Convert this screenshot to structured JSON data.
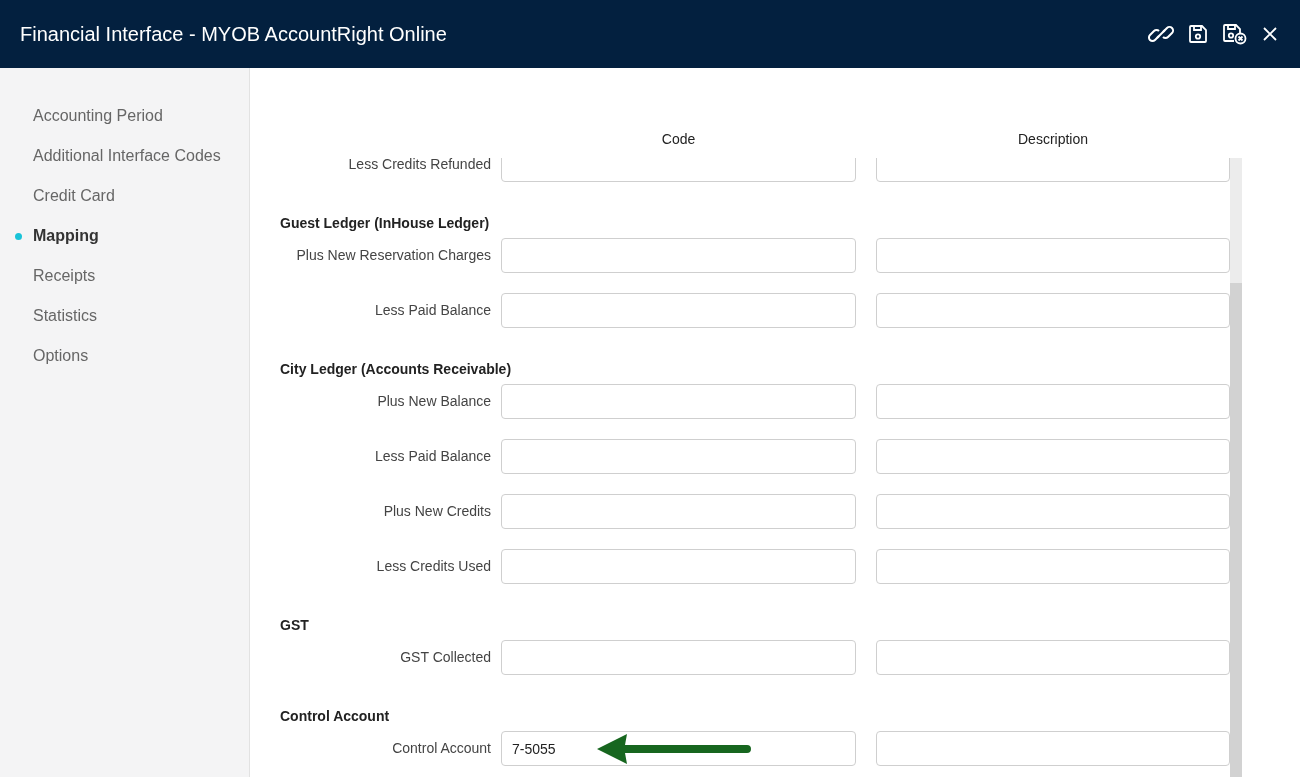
{
  "window": {
    "title": "Financial Interface - MYOB AccountRight Online"
  },
  "sidebar": {
    "items": [
      {
        "label": "Accounting Period",
        "selected": false
      },
      {
        "label": "Additional Interface Codes",
        "selected": false
      },
      {
        "label": "Credit Card",
        "selected": false
      },
      {
        "label": "Mapping",
        "selected": true
      },
      {
        "label": "Receipts",
        "selected": false
      },
      {
        "label": "Statistics",
        "selected": false
      },
      {
        "label": "Options",
        "selected": false
      }
    ]
  },
  "columns": [
    "Code",
    "Description"
  ],
  "rows": [
    {
      "kind": "field",
      "label": "Less Credits Refunded",
      "code": "",
      "description": ""
    },
    {
      "kind": "section",
      "label": "Guest Ledger (InHouse Ledger)"
    },
    {
      "kind": "field",
      "label": "Plus New Reservation Charges",
      "code": "",
      "description": ""
    },
    {
      "kind": "field",
      "label": "Less Paid Balance",
      "code": "",
      "description": ""
    },
    {
      "kind": "section",
      "label": "City Ledger (Accounts Receivable)"
    },
    {
      "kind": "field",
      "label": "Plus New Balance",
      "code": "",
      "description": ""
    },
    {
      "kind": "field",
      "label": "Less Paid Balance",
      "code": "",
      "description": ""
    },
    {
      "kind": "field",
      "label": "Plus New Credits",
      "code": "",
      "description": ""
    },
    {
      "kind": "field",
      "label": "Less Credits Used",
      "code": "",
      "description": ""
    },
    {
      "kind": "section",
      "label": "GST"
    },
    {
      "kind": "field",
      "label": "GST Collected",
      "code": "",
      "description": ""
    },
    {
      "kind": "section",
      "label": "Control Account"
    },
    {
      "kind": "field",
      "label": "Control Account",
      "code": "7-5055",
      "description": "",
      "arrow": true
    }
  ]
}
